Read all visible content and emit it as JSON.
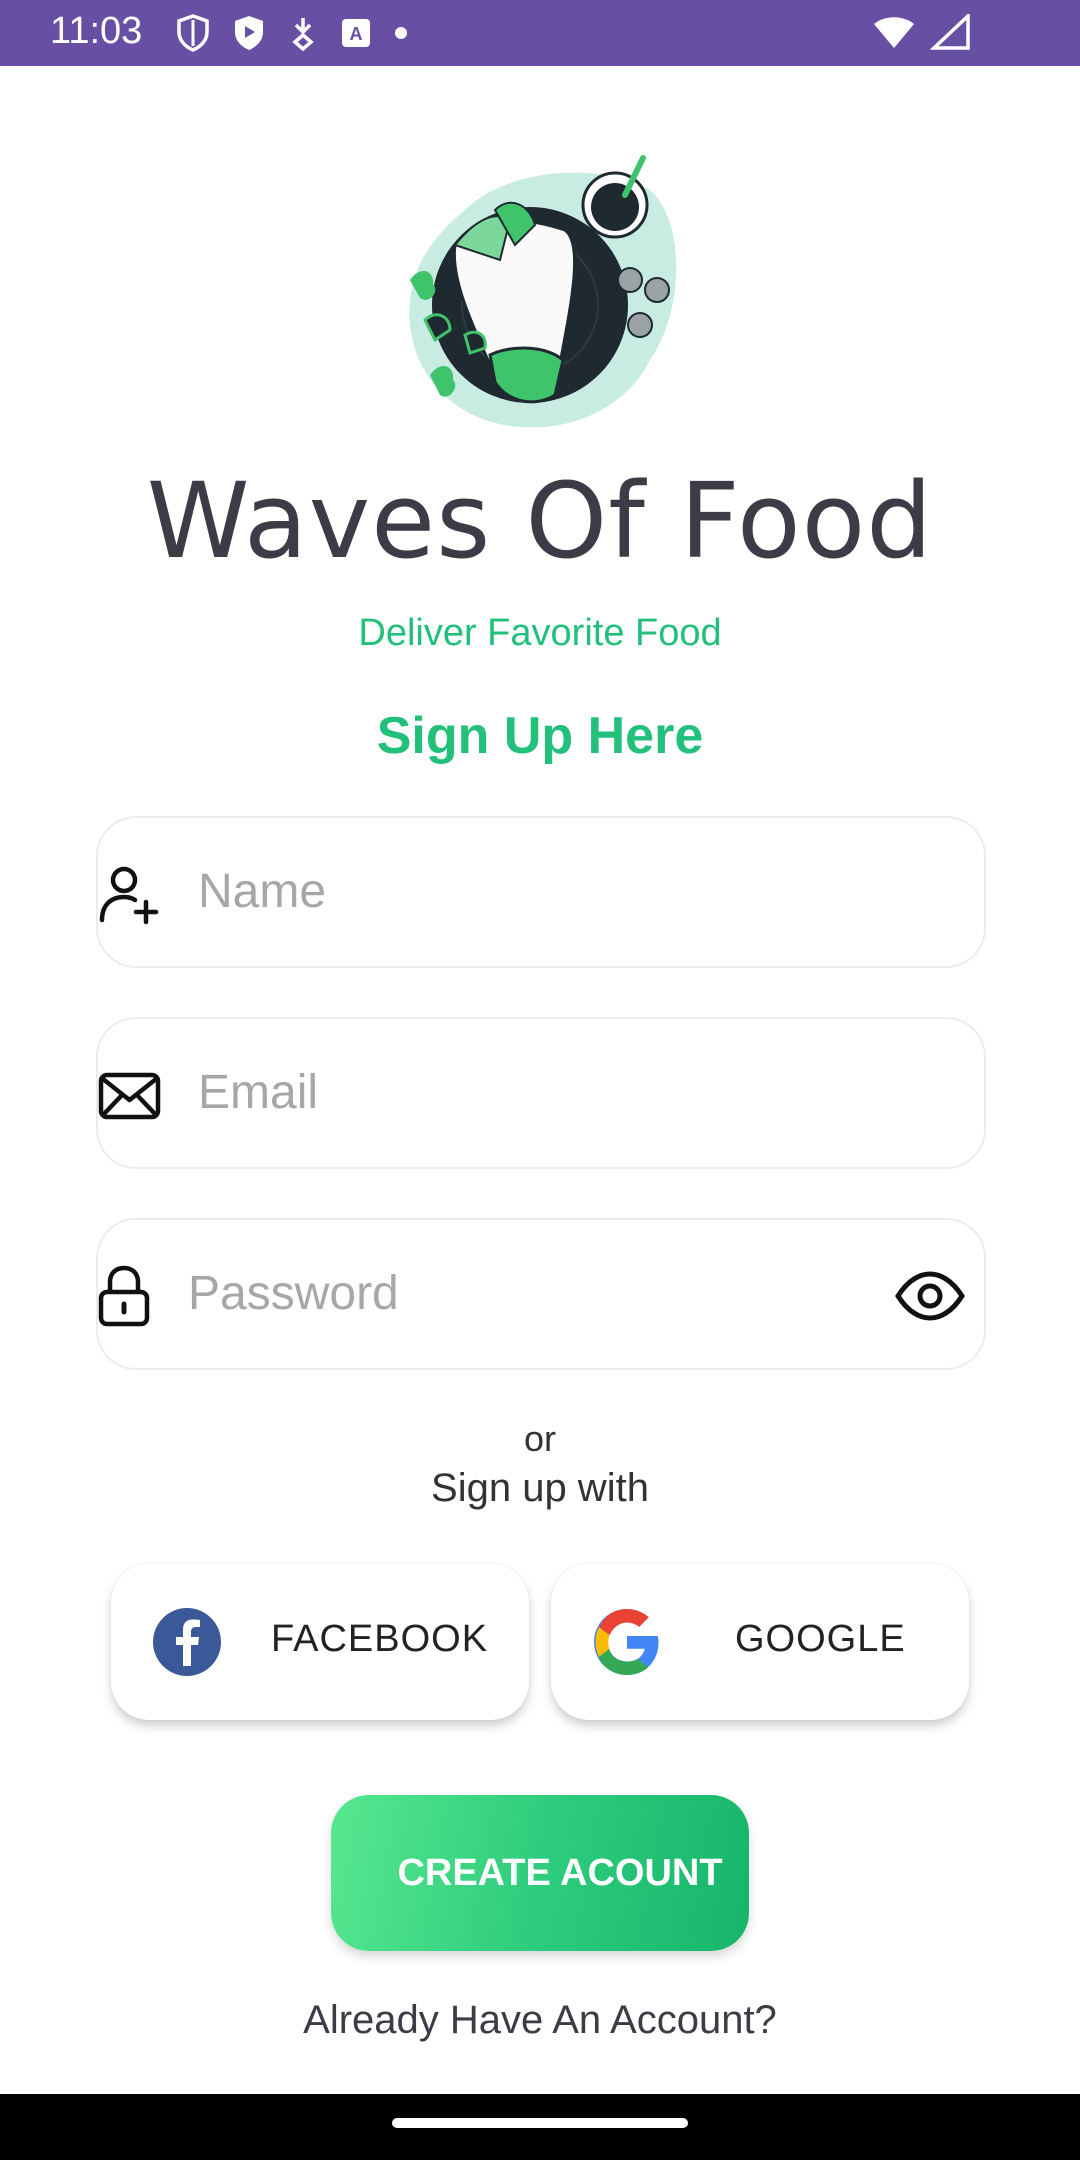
{
  "status_bar": {
    "time": "11:03",
    "icons": [
      "shield-icon",
      "play-protect-icon",
      "download-icon",
      "accessibility-icon",
      "dot-icon"
    ],
    "right_icons": [
      "wifi-icon",
      "signal-icon"
    ],
    "color": "#6750a4"
  },
  "header": {
    "app_title": "Waves Of Food",
    "tagline": "Deliver Favorite Food",
    "signup_title": "Sign Up Here"
  },
  "form": {
    "name_placeholder": "Name",
    "email_placeholder": "Email",
    "password_placeholder": "Password"
  },
  "divider": {
    "or": "or",
    "signup_with": "Sign up with"
  },
  "social": {
    "facebook_label": "FACEBOOK",
    "google_label": "GOOGLE"
  },
  "actions": {
    "create_label": "CREATE ACOUNT",
    "already_label": "Already Have An Account?"
  },
  "colors": {
    "accent": "#22c07a",
    "title": "#3d3b45",
    "placeholder": "#a7a7a7"
  }
}
